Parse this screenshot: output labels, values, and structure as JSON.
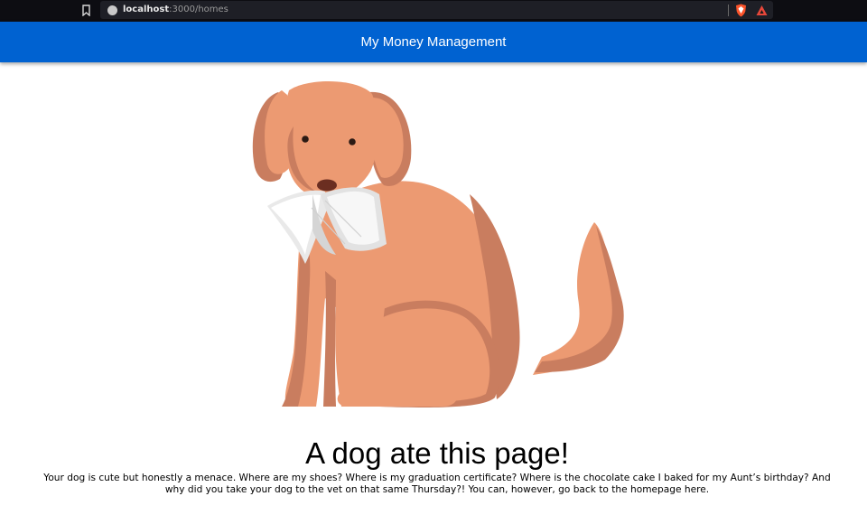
{
  "browser": {
    "url_host": "localhost",
    "url_path": ":3000/homes",
    "icons": {
      "bookmark": "bookmark-icon",
      "site_info": "info-icon",
      "brave_shield": "brave-shield-icon",
      "rewards": "brave-rewards-icon"
    }
  },
  "header": {
    "title": "My Money Management",
    "color": "#0062d1"
  },
  "illustration": {
    "icon": "dog-with-paper-icon",
    "fur_color": "#ec9a72",
    "shade_color": "#c97d5f"
  },
  "content": {
    "heading": "A dog ate this page!",
    "message": "Your dog is cute but honestly a menace. Where are my shoes? Where is my graduation certificate? Where is the chocolate cake I baked for my Aunt’s birthday? And why did you take your dog to the vet on that same Thursday?! You can, however, go back to the homepage here."
  }
}
